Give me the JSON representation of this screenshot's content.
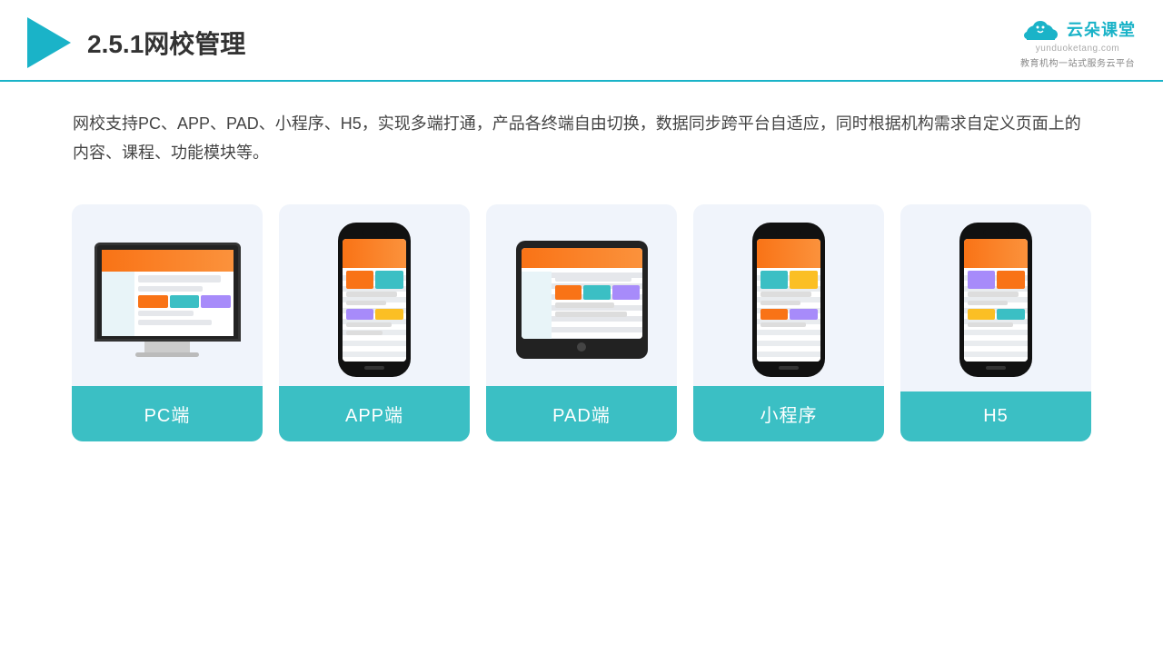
{
  "header": {
    "title": "2.5.1网校管理",
    "brand_cn": "云朵课堂",
    "brand_subtitle": "教育机构一站\n式服务云平台",
    "brand_url": "yunduoketang.com"
  },
  "description": {
    "text": "网校支持PC、APP、PAD、小程序、H5，实现多端打通，产品各终端自由切换，数据同步跨平台自适应，同时根据机构需求自定义页面上的内容、课程、功能模块等。"
  },
  "cards": [
    {
      "id": "pc",
      "label": "PC端",
      "type": "monitor"
    },
    {
      "id": "app",
      "label": "APP端",
      "type": "phone"
    },
    {
      "id": "pad",
      "label": "PAD端",
      "type": "tablet"
    },
    {
      "id": "miniapp",
      "label": "小程序",
      "type": "phone"
    },
    {
      "id": "h5",
      "label": "H5",
      "type": "phone"
    }
  ],
  "colors": {
    "accent": "#1ab3c8",
    "card_bg": "#f0f4fb",
    "card_label_bg": "#3bbfc4",
    "card_label_text": "#ffffff"
  }
}
